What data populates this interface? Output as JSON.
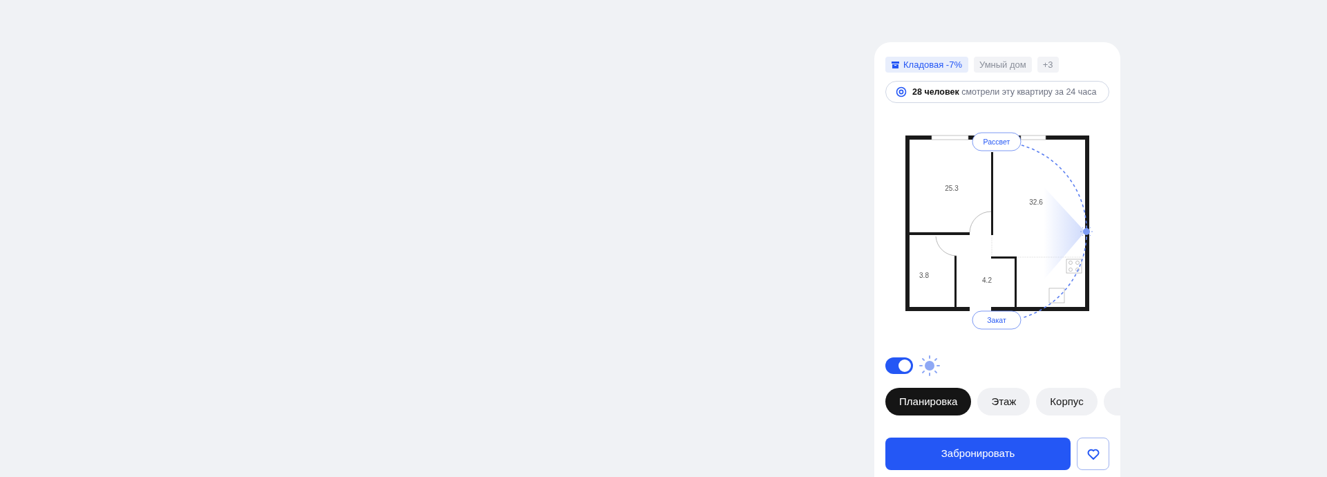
{
  "tags": [
    {
      "label": "Кладовая -7%",
      "kind": "promo"
    },
    {
      "label": "Умный дом",
      "kind": "plain"
    },
    {
      "label": "+3",
      "kind": "plain"
    }
  ],
  "views_notice": {
    "text": "**28 человек** смотрели эту квартиру за 24 часа"
  },
  "floor_plan": {
    "rooms": [
      {
        "area": "25.3"
      },
      {
        "area": "32.6"
      },
      {
        "area": "3.8"
      },
      {
        "area": "4.2"
      }
    ],
    "sunrise_label": "Рассвет",
    "sunset_label": "Закат"
  },
  "sun_toggle": {
    "on": true
  },
  "tabs": [
    {
      "label": "Планировка",
      "selected": true
    },
    {
      "label": "Этаж",
      "selected": false
    },
    {
      "label": "Корпус",
      "selected": false
    }
  ],
  "book_button": "Забронировать"
}
